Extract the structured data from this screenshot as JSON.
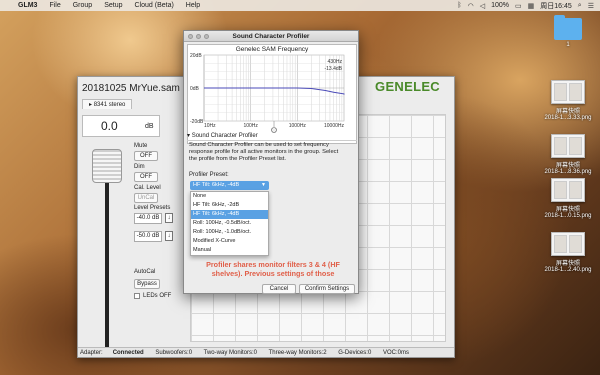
{
  "menubar": {
    "app_name": "GLM3",
    "items": [
      "File",
      "Group",
      "Setup",
      "Cloud (Beta)",
      "Help"
    ],
    "battery": "100%",
    "clock": "周日16:45"
  },
  "desktop": {
    "folder_label": "1",
    "files": [
      {
        "line1": "屏幕快照",
        "line2": "2018-1...3.33.png"
      },
      {
        "line1": "屏幕快照",
        "line2": "2018-1...8.36.png"
      },
      {
        "line1": "屏幕快照",
        "line2": "2018-1...0.15.png"
      },
      {
        "line1": "屏幕快照",
        "line2": "2018-1...2.40.png"
      }
    ]
  },
  "main_window": {
    "project_title": "20181025 MrYue.sam",
    "logo": "GENELEC",
    "tab": "8341 stereo",
    "volume_value": "0.0",
    "volume_unit": "dB",
    "mute_label": "Mute",
    "mute_button": "OFF",
    "dim_label": "Dim",
    "dim_button": "OFF",
    "cal_level_label": "Cal. Level",
    "cal_button": "UnCal",
    "level_presets_label": "Level Presets",
    "preset1": "-40.0 dB",
    "preset2": "-50.0 dB",
    "autocal_label": "AutoCal",
    "bypass_button": "Bypass",
    "leds_label": "LEDs OFF"
  },
  "status_bar": {
    "adapter": "Adapter:",
    "adapter_value": "Connected",
    "subwoofers": "Subwoofers:0",
    "two_way": "Two-way Monitors:0",
    "three_way": "Three-way Monitors:2",
    "g_devices": "G-Devices:0",
    "voc": "VOC:0ms"
  },
  "dialog": {
    "title": "Sound Character Profiler",
    "chart_title": "Genelec SAM Frequency",
    "section_title": "Sound Character Profiler",
    "description": "Sound Character Profiler can be used to set frequency response profile for all active monitors in the group. Select the profile from the Profiler Preset list.",
    "preset_label": "Profiler Preset:",
    "selected_preset": "HF Tilt: 6kHz, -4dB",
    "options": [
      "None",
      "HF Tilt: 6kHz, -2dB",
      "HF Tilt: 6kHz, -4dB",
      "Roll: 100Hz, -0.5dB/oct.",
      "Roll: 100Hz, -1.0dB/oct.",
      "Modified X-Curve",
      "Manual"
    ],
    "warning": "Profiler shares monitor filters 3 & 4 (HF shelves). Previous settings of those",
    "cancel": "Cancel",
    "confirm": "Confirm Settings"
  },
  "chart_data": {
    "type": "line",
    "title": "Genelec SAM Frequency",
    "xlabel": "",
    "ylabel": "",
    "x_scale": "log",
    "xlim": [
      10,
      10000
    ],
    "ylim": [
      -20,
      20
    ],
    "x_tick_labels": [
      "10Hz",
      "100Hz",
      "1000Hz",
      "10000Hz"
    ],
    "y_tick_labels": [
      "20dB",
      "0dB",
      "-20dB"
    ],
    "readout": [
      "430Hz",
      "-13.4dB"
    ],
    "series": [
      {
        "x": [
          10,
          100,
          1000,
          2000,
          4000,
          6000,
          10000,
          20000
        ],
        "y": [
          0,
          0,
          0,
          -0.3,
          -1.5,
          -2.6,
          -3.6,
          -4
        ]
      }
    ],
    "grid": true,
    "line_color": "#4a4ab8"
  }
}
